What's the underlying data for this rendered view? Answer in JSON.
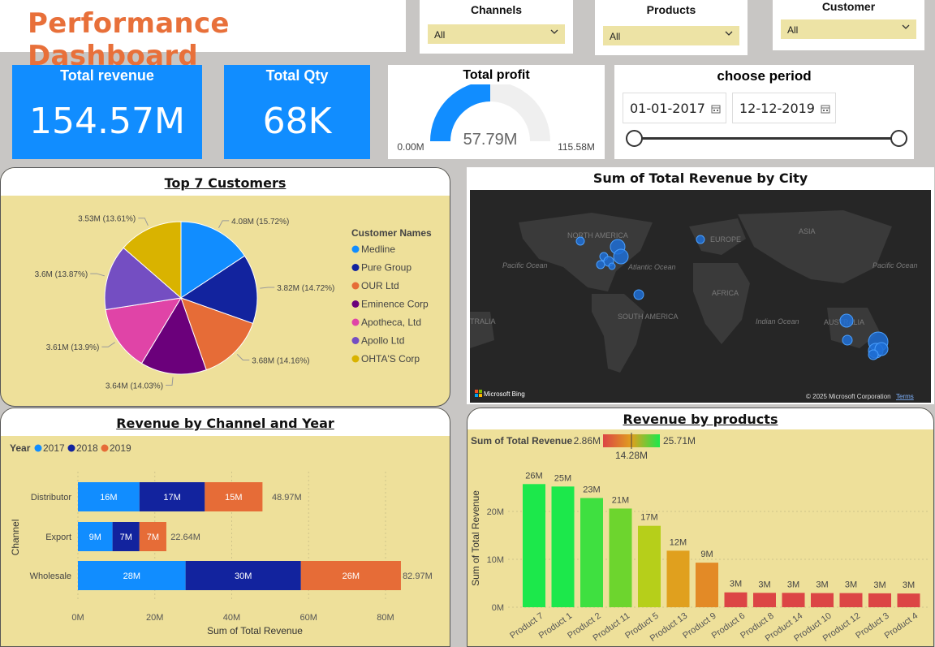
{
  "header": {
    "title": "Performance Dashboard"
  },
  "slicers": [
    {
      "label": "Channels",
      "value": "All"
    },
    {
      "label": "Products",
      "value": "All"
    },
    {
      "label": "Customer",
      "value": "All"
    }
  ],
  "kpis": {
    "revenue": {
      "label": "Total revenue",
      "value": "154.57M"
    },
    "qty": {
      "label": "Total Qty",
      "value": "68K"
    }
  },
  "profit": {
    "title": "Total profit",
    "value": "57.79M",
    "min": "0.00M",
    "max": "115.58M",
    "fraction": 0.5
  },
  "period": {
    "title": "choose period",
    "start": "01-01-2017",
    "end": "12-12-2019"
  },
  "colors": {
    "accent": "#118dff",
    "title_orange": "#e8703a",
    "card_bg": "#eee09a",
    "dark_blue": "#12239e",
    "orange": "#e66c37"
  },
  "pie": {
    "title": "Top 7 Customers",
    "legend_title": "Customer Names",
    "chart_data": {
      "type": "pie",
      "slices": [
        {
          "name": "Medline",
          "value": 4.08,
          "label": "4.08M (15.72%)",
          "color": "#118dff"
        },
        {
          "name": "Pure Group",
          "value": 3.82,
          "label": "3.82M (14.72%)",
          "color": "#12239e"
        },
        {
          "name": "OUR Ltd",
          "value": 3.68,
          "label": "3.68M (14.16%)",
          "color": "#e66c37"
        },
        {
          "name": "Eminence Corp",
          "value": 3.64,
          "label": "3.64M (14.03%)",
          "color": "#6b007b"
        },
        {
          "name": "Apotheca, Ltd",
          "value": 3.61,
          "label": "3.61M (13.9%)",
          "color": "#e044a7"
        },
        {
          "name": "Apollo Ltd",
          "value": 3.6,
          "label": "3.6M (13.87%)",
          "color": "#744ec2"
        },
        {
          "name": "OHTA'S Corp",
          "value": 3.53,
          "label": "3.53M (13.61%)",
          "color": "#d9b300"
        }
      ]
    }
  },
  "map": {
    "title": "Sum of Total Revenue by City",
    "labels": [
      "NORTH AMERICA",
      "EUROPE",
      "ASIA",
      "AFRICA",
      "SOUTH AMERICA",
      "AUSTRALIA",
      "Pacific Ocean",
      "Atlantic Ocean",
      "Indian Ocean",
      "Pacific Ocean",
      "TRALIA"
    ],
    "bing": "Microsoft Bing",
    "copyright": "© 2025 Microsoft Corporation",
    "terms": "Terms"
  },
  "channel_chart": {
    "title": "Revenue by Channel and Year",
    "legend_title": "Year",
    "chart_data": {
      "type": "bar",
      "orientation": "horizontal-stacked",
      "categories": [
        "Distributor",
        "Export",
        "Wholesale"
      ],
      "series": [
        {
          "name": "2017",
          "values": [
            16,
            9,
            28
          ],
          "labels": [
            "16M",
            "9M",
            "28M"
          ],
          "color": "#118dff"
        },
        {
          "name": "2018",
          "values": [
            17,
            7,
            30
          ],
          "labels": [
            "17M",
            "7M",
            "30M"
          ],
          "color": "#12239e"
        },
        {
          "name": "2019",
          "values": [
            15,
            7,
            26
          ],
          "labels": [
            "15M",
            "7M",
            "26M"
          ],
          "color": "#e66c37"
        }
      ],
      "totals": [
        "48.97M",
        "22.64M",
        "82.97M"
      ],
      "total_values": [
        48.97,
        22.64,
        82.97
      ],
      "xlabel": "Sum of Total Revenue",
      "ylabel": "Channel",
      "xticks": [
        "0M",
        "20M",
        "40M",
        "60M",
        "80M"
      ],
      "xlim": [
        0,
        80
      ]
    }
  },
  "product_chart": {
    "title": "Revenue by products",
    "gradient": {
      "label": "Sum of Total Revenue",
      "min": "2.86M",
      "max": "25.71M",
      "mid": "14.28M"
    },
    "chart_data": {
      "type": "bar",
      "categories": [
        "Product 7",
        "Product 1",
        "Product 2",
        "Product 11",
        "Product 5",
        "Product 13",
        "Product 9",
        "Product 6",
        "Product 8",
        "Product 14",
        "Product 10",
        "Product 12",
        "Product 3",
        "Product 4"
      ],
      "values": [
        25.71,
        25.2,
        22.8,
        20.6,
        17.0,
        11.8,
        9.3,
        3.1,
        3.0,
        3.0,
        2.95,
        2.95,
        2.9,
        2.86
      ],
      "labels": [
        "26M",
        "25M",
        "23M",
        "21M",
        "17M",
        "12M",
        "9M",
        "3M",
        "3M",
        "3M",
        "3M",
        "3M",
        "3M",
        "3M"
      ],
      "colors": [
        "#1ce84b",
        "#1ce84b",
        "#3fe040",
        "#6dd52e",
        "#b6cf1a",
        "#e0a01e",
        "#e38a26",
        "#dc4545",
        "#dc4545",
        "#dc4545",
        "#dc4545",
        "#dc4545",
        "#dc4545",
        "#dc4545"
      ],
      "ylabel": "Sum of Total Revenue",
      "yticks": [
        "0M",
        "10M",
        "20M"
      ],
      "ylim": [
        0,
        28
      ]
    }
  }
}
